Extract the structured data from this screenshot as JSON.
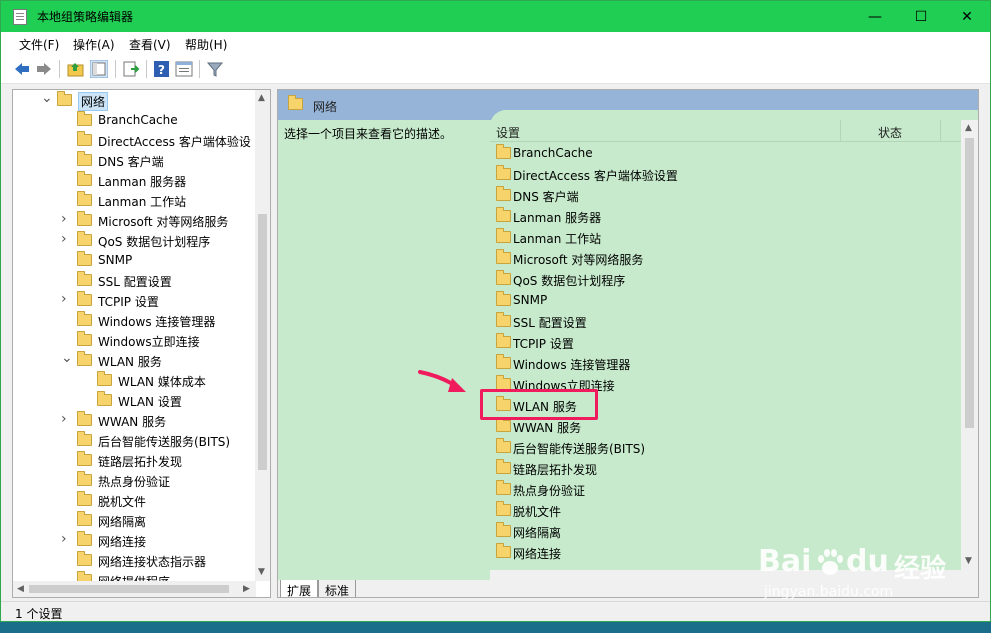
{
  "window": {
    "title": "本地组策略编辑器",
    "minimize": "—",
    "maximize": "☐",
    "close": "✕"
  },
  "menu": [
    "文件(F)",
    "操作(A)",
    "查看(V)",
    "帮助(H)"
  ],
  "tree": {
    "items": [
      {
        "label": "网络",
        "level": 0,
        "arrow": "expanded",
        "selected": true
      },
      {
        "label": "BranchCache",
        "level": 1,
        "arrow": "none"
      },
      {
        "label": "DirectAccess 客户端体验设",
        "level": 1,
        "arrow": "none"
      },
      {
        "label": "DNS 客户端",
        "level": 1,
        "arrow": "none"
      },
      {
        "label": "Lanman 服务器",
        "level": 1,
        "arrow": "none"
      },
      {
        "label": "Lanman 工作站",
        "level": 1,
        "arrow": "none"
      },
      {
        "label": "Microsoft 对等网络服务",
        "level": 1,
        "arrow": "collapsed"
      },
      {
        "label": "QoS 数据包计划程序",
        "level": 1,
        "arrow": "collapsed"
      },
      {
        "label": "SNMP",
        "level": 1,
        "arrow": "none"
      },
      {
        "label": "SSL 配置设置",
        "level": 1,
        "arrow": "none"
      },
      {
        "label": "TCPIP 设置",
        "level": 1,
        "arrow": "collapsed"
      },
      {
        "label": "Windows 连接管理器",
        "level": 1,
        "arrow": "none"
      },
      {
        "label": "Windows立即连接",
        "level": 1,
        "arrow": "none"
      },
      {
        "label": "WLAN 服务",
        "level": 1,
        "arrow": "expanded"
      },
      {
        "label": "WLAN 媒体成本",
        "level": 2,
        "arrow": "none"
      },
      {
        "label": "WLAN 设置",
        "level": 2,
        "arrow": "none"
      },
      {
        "label": "WWAN 服务",
        "level": 1,
        "arrow": "collapsed"
      },
      {
        "label": "后台智能传送服务(BITS)",
        "level": 1,
        "arrow": "none"
      },
      {
        "label": "链路层拓扑发现",
        "level": 1,
        "arrow": "none"
      },
      {
        "label": "热点身份验证",
        "level": 1,
        "arrow": "none"
      },
      {
        "label": "脱机文件",
        "level": 1,
        "arrow": "none"
      },
      {
        "label": "网络隔离",
        "level": 1,
        "arrow": "none"
      },
      {
        "label": "网络连接",
        "level": 1,
        "arrow": "collapsed"
      },
      {
        "label": "网络连接状态指示器",
        "level": 1,
        "arrow": "none"
      },
      {
        "label": "网络提供程序",
        "level": 1,
        "arrow": "none"
      }
    ]
  },
  "right": {
    "header": "网络",
    "description": "选择一个项目来查看它的描述。",
    "columns": {
      "setting": "设置",
      "state": "状态"
    },
    "rows": [
      "BranchCache",
      "DirectAccess 客户端体验设置",
      "DNS 客户端",
      "Lanman 服务器",
      "Lanman 工作站",
      "Microsoft 对等网络服务",
      "QoS 数据包计划程序",
      "SNMP",
      "SSL 配置设置",
      "TCPIP 设置",
      "Windows 连接管理器",
      "Windows立即连接",
      "WLAN 服务",
      "WWAN 服务",
      "后台智能传送服务(BITS)",
      "链路层拓扑发现",
      "热点身份验证",
      "脱机文件",
      "网络隔离",
      "网络连接"
    ],
    "highlighted_row": "WLAN 服务"
  },
  "tabs": [
    "扩展",
    "标准"
  ],
  "status": "1 个设置",
  "watermark": {
    "brand": "Bai",
    "brand2": "du",
    "brand_cn": "经验",
    "url": "jingyan.baidu.com"
  },
  "colors": {
    "titlebar": "#1fce52",
    "pane": "#c6eacb",
    "header": "#95b4d8",
    "highlight": "#ef1b5d"
  }
}
